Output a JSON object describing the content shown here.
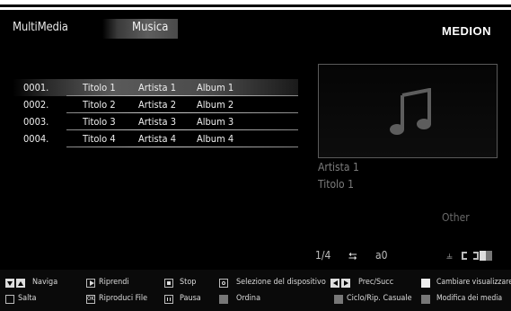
{
  "header": {
    "app_title": "MultiMedia",
    "tab_label": "Musica",
    "brand": "MEDION"
  },
  "playlist": [
    {
      "num": "0001.",
      "title": "Titolo 1",
      "artist": "Artista 1",
      "album": "Album 1"
    },
    {
      "num": "0002.",
      "title": "Titolo 2",
      "artist": "Artista 2",
      "album": "Album 2"
    },
    {
      "num": "0003.",
      "title": "Titolo 3",
      "artist": "Artista 3",
      "album": "Album 3"
    },
    {
      "num": "0004.",
      "title": "Titolo 4",
      "artist": "Artista 4",
      "album": "Album 4"
    }
  ],
  "now_playing": {
    "artist": "Artista 1",
    "title": "Titolo 1",
    "genre": "Other",
    "art_icon": "music-note-icon"
  },
  "status": {
    "track_count": "1/4",
    "device_icon": "usb-icon",
    "device": "a0",
    "icons": [
      "shuffle-icon",
      "repeat-icon",
      "bars-icon"
    ]
  },
  "help": {
    "naviga": "Naviga",
    "salta": "Salta",
    "riprendi": "Riprendi",
    "riproduci_file": "Riproduci File",
    "stop": "Stop",
    "pausa": "Pausa",
    "selezione": "Selezione del dispositivo",
    "ordina": "Ordina",
    "prec_succ": "Prec/Succ",
    "ciclo": "Ciclo/Rip. Casuale",
    "cambiare": "Cambiare visualizzare",
    "modifica": "Modifica dei media",
    "ok_key": "OK"
  },
  "colors": {
    "background": "#000000",
    "text": "#f0f0f0",
    "dim_text": "#7c7c7c",
    "help_gray_key": "#777777"
  }
}
